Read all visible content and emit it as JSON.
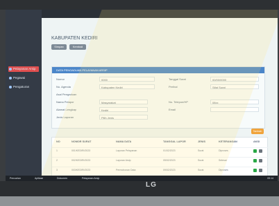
{
  "app": {
    "title": "KABUPATEN KEDIRI",
    "buttons": {
      "primary": "Simpan",
      "secondary": "Kembali"
    }
  },
  "sidebar": {
    "items": [
      {
        "label": "Pelayanan Arsip",
        "active": true
      },
      {
        "label": "Pegawai",
        "active": false
      },
      {
        "label": "Pengaturan",
        "active": false
      }
    ]
  },
  "form": {
    "header": "DATA PENGADUAN PELAYANAN ARSIP",
    "fields": [
      {
        "label": "Nomor",
        "value": "0000",
        "label2": "Tanggal Surat",
        "value2": "00/00/0000"
      },
      {
        "label": "No. Agenda",
        "value": "Kabupaten Kediri",
        "label2": "Perihal",
        "value2": "Sifat Surat"
      },
      {
        "label": "Asal Pengaduan",
        "value": "",
        "label2": "",
        "value2": ""
      },
      {
        "label": "Nama Pelapor",
        "value": "Masyarakat",
        "label2": "No. Telepon/HP",
        "value2": "08xx"
      },
      {
        "label": "Alamat Lengkap",
        "value": "Kediri",
        "label2": "Email",
        "value2": ""
      },
      {
        "label": "Jenis Laporan",
        "value": "Pilih Jenis",
        "label2": "",
        "value2": ""
      }
    ],
    "add_button": "Tambah"
  },
  "table": {
    "headers": [
      "NO",
      "NOMOR SURAT",
      "NAMA DATA",
      "TANGGAL LAPOR",
      "JENIS",
      "KETERANGAN",
      "AKSI"
    ],
    "rows": [
      {
        "no": "1",
        "nomor": "001/KEDIRI/2023",
        "nama": "Laporan Pelayanan",
        "tanggal": "01/02/2023",
        "jenis": "Surat",
        "ket": "Diproses"
      },
      {
        "no": "2",
        "nomor": "002/KEDIRI/2023",
        "nama": "Laporan Arsip",
        "tanggal": "05/02/2023",
        "jenis": "Surat",
        "ket": "Selesai"
      },
      {
        "no": "3",
        "nomor": "003/KEDIRI/2023",
        "nama": "Permohonan Data",
        "tanggal": "09/02/2023",
        "jenis": "Surat",
        "ket": "Diproses"
      }
    ]
  },
  "taskbar": {
    "items": [
      "Pencarian",
      "Aplikasi",
      "Dokumen",
      "Pelayanan Arsip"
    ],
    "time": "09:14"
  },
  "monitor": {
    "brand": "LG"
  },
  "colors": {
    "header": "#4b86c9",
    "sidebar": "#343b46",
    "active": "#e14f4f",
    "add": "#f0a33a"
  }
}
